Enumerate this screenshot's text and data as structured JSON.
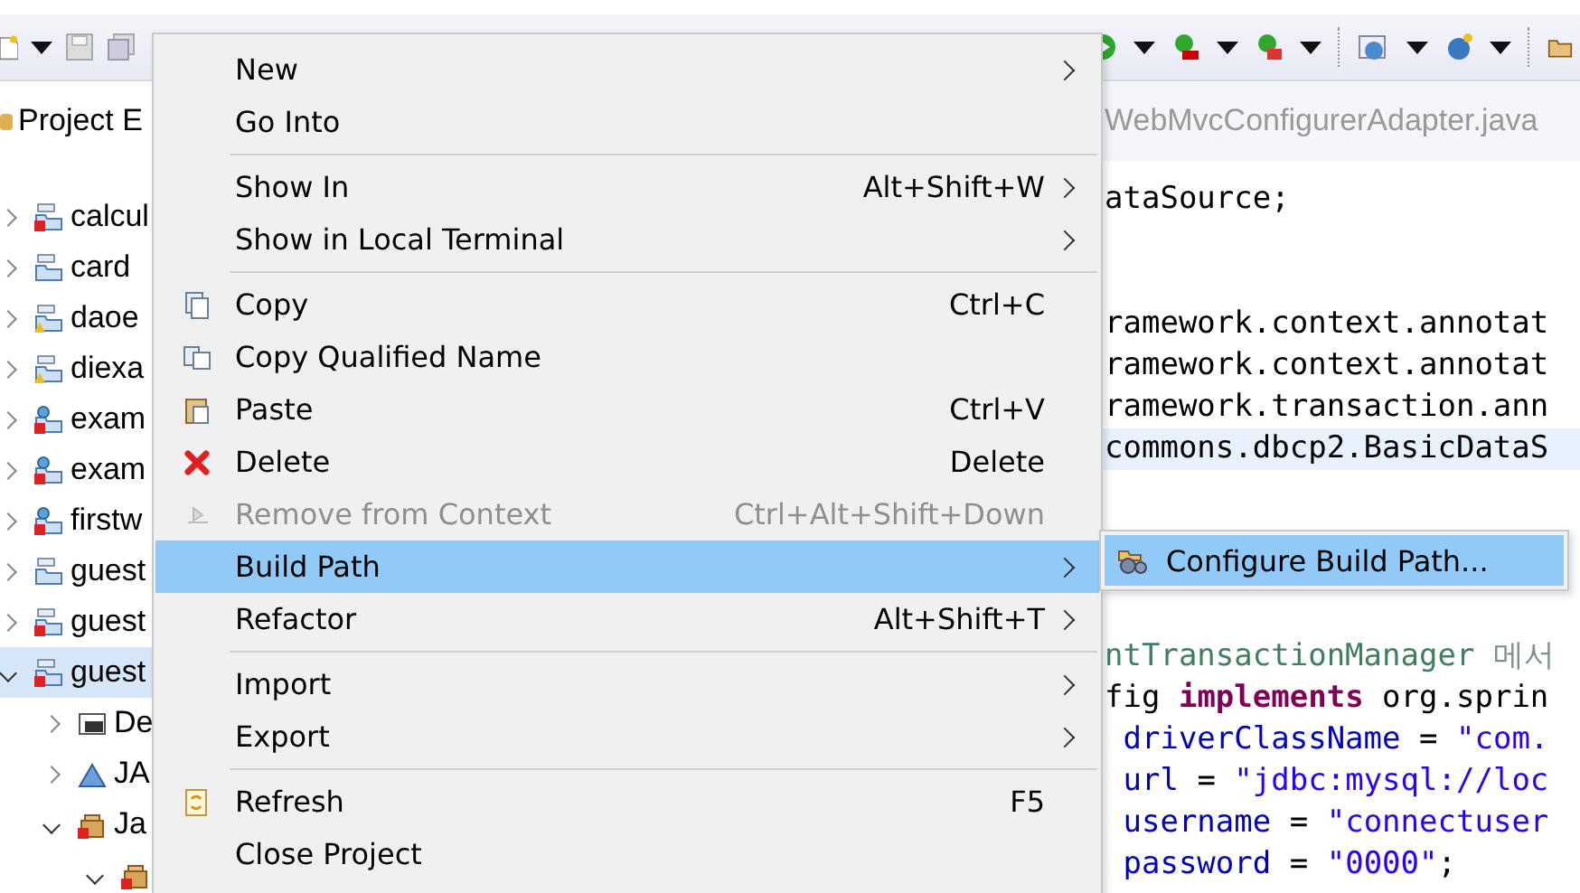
{
  "explorer": {
    "title": "Project E",
    "items": [
      {
        "label": "calcul",
        "kind": "project",
        "error": true,
        "warning": false,
        "expanded": false,
        "selected": false
      },
      {
        "label": "card",
        "kind": "project",
        "error": false,
        "warning": false,
        "expanded": false,
        "selected": false
      },
      {
        "label": "daoe",
        "kind": "project",
        "error": false,
        "warning": true,
        "expanded": false,
        "selected": false
      },
      {
        "label": "diexa",
        "kind": "project",
        "error": false,
        "warning": true,
        "expanded": false,
        "selected": false
      },
      {
        "label": "exam",
        "kind": "web-project",
        "error": true,
        "warning": false,
        "expanded": false,
        "selected": false
      },
      {
        "label": "exam",
        "kind": "web-project",
        "error": true,
        "warning": false,
        "expanded": false,
        "selected": false
      },
      {
        "label": "firstw",
        "kind": "web-project",
        "error": true,
        "warning": false,
        "expanded": false,
        "selected": false
      },
      {
        "label": "guest",
        "kind": "project",
        "error": false,
        "warning": false,
        "expanded": false,
        "selected": false
      },
      {
        "label": "guest",
        "kind": "project",
        "error": true,
        "warning": false,
        "expanded": false,
        "selected": false
      },
      {
        "label": "guest",
        "kind": "project",
        "error": true,
        "warning": false,
        "expanded": true,
        "selected": true,
        "children": [
          {
            "label": "De",
            "kind": "descriptor",
            "error": false,
            "warning": false,
            "expanded": false,
            "selected": false
          },
          {
            "label": "JA",
            "kind": "webservice",
            "error": false,
            "warning": false,
            "expanded": false,
            "selected": false
          },
          {
            "label": "Ja",
            "kind": "resources",
            "error": true,
            "warning": false,
            "expanded": true,
            "selected": false,
            "children": [
              {
                "kind": "package",
                "error": true,
                "warning": false,
                "expanded": true,
                "selected": false
              }
            ]
          }
        ]
      }
    ]
  },
  "editor": {
    "tab": "WebMvcConfigurerAdapter.java",
    "lines": [
      {
        "highlighted": false,
        "segments": [
          {
            "text": "ataSource;",
            "kind": "plain"
          }
        ]
      },
      {
        "kind": "blank"
      },
      {
        "kind": "blank"
      },
      {
        "highlighted": false,
        "segments": [
          {
            "text": "ramework.context.annotat",
            "kind": "plain"
          }
        ]
      },
      {
        "highlighted": false,
        "segments": [
          {
            "text": "ramework.context.annotat",
            "kind": "plain"
          }
        ]
      },
      {
        "highlighted": false,
        "segments": [
          {
            "text": "ramework.transaction.ann",
            "kind": "plain"
          }
        ]
      },
      {
        "highlighted": true,
        "segments": [
          {
            "text": "commons.dbcp2.BasicDataS",
            "kind": "plain"
          }
        ]
      },
      {
        "kind": "blank"
      },
      {
        "kind": "blank"
      },
      {
        "kind": "blank"
      },
      {
        "kind": "blank"
      },
      {
        "highlighted": false,
        "segments": [
          {
            "text": "ntTransactionManager",
            "kind": "comment"
          },
          {
            "text": " 메서",
            "kind": "comment-cjk"
          }
        ]
      },
      {
        "highlighted": false,
        "segments": [
          {
            "text": "fig ",
            "kind": "plain"
          },
          {
            "text": "implements",
            "kind": "keyword"
          },
          {
            "text": " org.sprin",
            "kind": "plain"
          }
        ]
      },
      {
        "highlighted": false,
        "segments": [
          {
            "text": " driverClassName",
            "kind": "field"
          },
          {
            "text": " = ",
            "kind": "plain"
          },
          {
            "text": "\"com.",
            "kind": "string"
          }
        ]
      },
      {
        "highlighted": false,
        "segments": [
          {
            "text": " url",
            "kind": "field"
          },
          {
            "text": " = ",
            "kind": "plain"
          },
          {
            "text": "\"jdbc:mysql://loc",
            "kind": "string"
          }
        ]
      },
      {
        "highlighted": false,
        "segments": [
          {
            "text": " username",
            "kind": "field"
          },
          {
            "text": " = ",
            "kind": "plain"
          },
          {
            "text": "\"connectuser",
            "kind": "string"
          }
        ]
      },
      {
        "highlighted": false,
        "segments": [
          {
            "text": " password",
            "kind": "field"
          },
          {
            "text": " = ",
            "kind": "plain"
          },
          {
            "text": "\"0000\"",
            "kind": "string"
          },
          {
            "text": ";",
            "kind": "plain"
          }
        ]
      }
    ]
  },
  "context_menu": {
    "items": [
      {
        "kind": "item",
        "label": "New",
        "submenu": true,
        "disabled": false,
        "selected": false
      },
      {
        "kind": "item",
        "label": "Go Into",
        "submenu": false,
        "disabled": false,
        "selected": false
      },
      {
        "kind": "separator"
      },
      {
        "kind": "item",
        "label": "Show In",
        "shortcut": "Alt+Shift+W",
        "submenu": true,
        "disabled": false,
        "selected": false
      },
      {
        "kind": "item",
        "label": "Show in Local Terminal",
        "submenu": true,
        "disabled": false,
        "selected": false
      },
      {
        "kind": "separator"
      },
      {
        "kind": "item",
        "label": "Copy",
        "shortcut": "Ctrl+C",
        "submenu": false,
        "disabled": false,
        "selected": false
      },
      {
        "kind": "item",
        "label": "Copy Qualified Name",
        "submenu": false,
        "disabled": false,
        "selected": false
      },
      {
        "kind": "item",
        "label": "Paste",
        "shortcut": "Ctrl+V",
        "submenu": false,
        "disabled": false,
        "selected": false
      },
      {
        "kind": "item",
        "label": "Delete",
        "shortcut": "Delete",
        "submenu": false,
        "disabled": false,
        "selected": false
      },
      {
        "kind": "item",
        "label": "Remove from Context",
        "shortcut": "Ctrl+Alt+Shift+Down",
        "submenu": false,
        "disabled": true,
        "selected": false
      },
      {
        "kind": "item",
        "label": "Build Path",
        "submenu": true,
        "disabled": false,
        "selected": true
      },
      {
        "kind": "item",
        "label": "Refactor",
        "shortcut": "Alt+Shift+T",
        "submenu": true,
        "disabled": false,
        "selected": false
      },
      {
        "kind": "separator"
      },
      {
        "kind": "item",
        "label": "Import",
        "submenu": true,
        "disabled": false,
        "selected": false
      },
      {
        "kind": "item",
        "label": "Export",
        "submenu": true,
        "disabled": false,
        "selected": false
      },
      {
        "kind": "separator"
      },
      {
        "kind": "item",
        "label": "Refresh",
        "shortcut": "F5",
        "submenu": false,
        "disabled": false,
        "selected": false
      },
      {
        "kind": "item",
        "label": "Close Project",
        "submenu": false,
        "disabled": false,
        "selected": false
      }
    ]
  },
  "submenu": {
    "items": [
      {
        "label": "Configure Build Path...",
        "selected": true
      }
    ]
  }
}
